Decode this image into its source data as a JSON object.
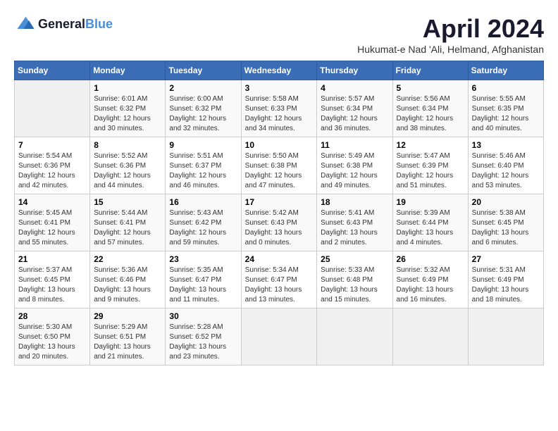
{
  "header": {
    "logo_line1": "General",
    "logo_line2": "Blue",
    "month": "April 2024",
    "location": "Hukumat-e Nad 'Ali, Helmand, Afghanistan"
  },
  "days_of_week": [
    "Sunday",
    "Monday",
    "Tuesday",
    "Wednesday",
    "Thursday",
    "Friday",
    "Saturday"
  ],
  "weeks": [
    [
      {
        "day": "",
        "info": ""
      },
      {
        "day": "1",
        "info": "Sunrise: 6:01 AM\nSunset: 6:32 PM\nDaylight: 12 hours\nand 30 minutes."
      },
      {
        "day": "2",
        "info": "Sunrise: 6:00 AM\nSunset: 6:32 PM\nDaylight: 12 hours\nand 32 minutes."
      },
      {
        "day": "3",
        "info": "Sunrise: 5:58 AM\nSunset: 6:33 PM\nDaylight: 12 hours\nand 34 minutes."
      },
      {
        "day": "4",
        "info": "Sunrise: 5:57 AM\nSunset: 6:34 PM\nDaylight: 12 hours\nand 36 minutes."
      },
      {
        "day": "5",
        "info": "Sunrise: 5:56 AM\nSunset: 6:34 PM\nDaylight: 12 hours\nand 38 minutes."
      },
      {
        "day": "6",
        "info": "Sunrise: 5:55 AM\nSunset: 6:35 PM\nDaylight: 12 hours\nand 40 minutes."
      }
    ],
    [
      {
        "day": "7",
        "info": "Sunrise: 5:54 AM\nSunset: 6:36 PM\nDaylight: 12 hours\nand 42 minutes."
      },
      {
        "day": "8",
        "info": "Sunrise: 5:52 AM\nSunset: 6:36 PM\nDaylight: 12 hours\nand 44 minutes."
      },
      {
        "day": "9",
        "info": "Sunrise: 5:51 AM\nSunset: 6:37 PM\nDaylight: 12 hours\nand 46 minutes."
      },
      {
        "day": "10",
        "info": "Sunrise: 5:50 AM\nSunset: 6:38 PM\nDaylight: 12 hours\nand 47 minutes."
      },
      {
        "day": "11",
        "info": "Sunrise: 5:49 AM\nSunset: 6:38 PM\nDaylight: 12 hours\nand 49 minutes."
      },
      {
        "day": "12",
        "info": "Sunrise: 5:47 AM\nSunset: 6:39 PM\nDaylight: 12 hours\nand 51 minutes."
      },
      {
        "day": "13",
        "info": "Sunrise: 5:46 AM\nSunset: 6:40 PM\nDaylight: 12 hours\nand 53 minutes."
      }
    ],
    [
      {
        "day": "14",
        "info": "Sunrise: 5:45 AM\nSunset: 6:41 PM\nDaylight: 12 hours\nand 55 minutes."
      },
      {
        "day": "15",
        "info": "Sunrise: 5:44 AM\nSunset: 6:41 PM\nDaylight: 12 hours\nand 57 minutes."
      },
      {
        "day": "16",
        "info": "Sunrise: 5:43 AM\nSunset: 6:42 PM\nDaylight: 12 hours\nand 59 minutes."
      },
      {
        "day": "17",
        "info": "Sunrise: 5:42 AM\nSunset: 6:43 PM\nDaylight: 13 hours\nand 0 minutes."
      },
      {
        "day": "18",
        "info": "Sunrise: 5:41 AM\nSunset: 6:43 PM\nDaylight: 13 hours\nand 2 minutes."
      },
      {
        "day": "19",
        "info": "Sunrise: 5:39 AM\nSunset: 6:44 PM\nDaylight: 13 hours\nand 4 minutes."
      },
      {
        "day": "20",
        "info": "Sunrise: 5:38 AM\nSunset: 6:45 PM\nDaylight: 13 hours\nand 6 minutes."
      }
    ],
    [
      {
        "day": "21",
        "info": "Sunrise: 5:37 AM\nSunset: 6:45 PM\nDaylight: 13 hours\nand 8 minutes."
      },
      {
        "day": "22",
        "info": "Sunrise: 5:36 AM\nSunset: 6:46 PM\nDaylight: 13 hours\nand 9 minutes."
      },
      {
        "day": "23",
        "info": "Sunrise: 5:35 AM\nSunset: 6:47 PM\nDaylight: 13 hours\nand 11 minutes."
      },
      {
        "day": "24",
        "info": "Sunrise: 5:34 AM\nSunset: 6:47 PM\nDaylight: 13 hours\nand 13 minutes."
      },
      {
        "day": "25",
        "info": "Sunrise: 5:33 AM\nSunset: 6:48 PM\nDaylight: 13 hours\nand 15 minutes."
      },
      {
        "day": "26",
        "info": "Sunrise: 5:32 AM\nSunset: 6:49 PM\nDaylight: 13 hours\nand 16 minutes."
      },
      {
        "day": "27",
        "info": "Sunrise: 5:31 AM\nSunset: 6:49 PM\nDaylight: 13 hours\nand 18 minutes."
      }
    ],
    [
      {
        "day": "28",
        "info": "Sunrise: 5:30 AM\nSunset: 6:50 PM\nDaylight: 13 hours\nand 20 minutes."
      },
      {
        "day": "29",
        "info": "Sunrise: 5:29 AM\nSunset: 6:51 PM\nDaylight: 13 hours\nand 21 minutes."
      },
      {
        "day": "30",
        "info": "Sunrise: 5:28 AM\nSunset: 6:52 PM\nDaylight: 13 hours\nand 23 minutes."
      },
      {
        "day": "",
        "info": ""
      },
      {
        "day": "",
        "info": ""
      },
      {
        "day": "",
        "info": ""
      },
      {
        "day": "",
        "info": ""
      }
    ]
  ]
}
